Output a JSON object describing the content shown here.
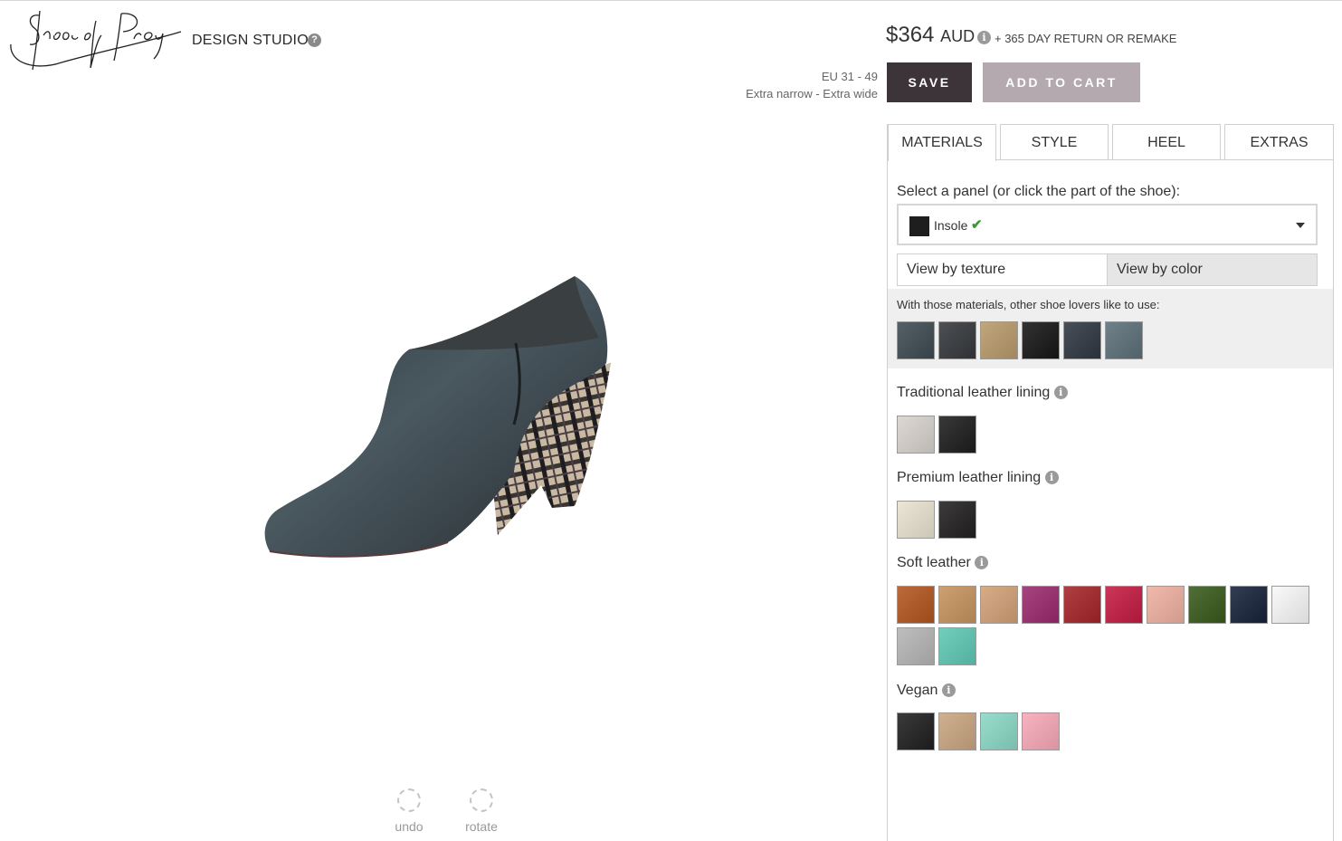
{
  "brand": {
    "logo_alt": "Shoes of Prey",
    "studio_label": "DESIGN STUDIO",
    "help_icon": "?"
  },
  "price": {
    "amount": "$364",
    "currency": "AUD",
    "info_icon": "i",
    "returns": "+ 365 DAY RETURN OR REMAKE"
  },
  "sizes": {
    "range": "EU 31 - 49",
    "widths": "Extra narrow - Extra wide"
  },
  "actions": {
    "save": "SAVE",
    "add_to_cart": "ADD TO CART"
  },
  "tabs": [
    {
      "label": "MATERIALS",
      "active": true
    },
    {
      "label": "STYLE",
      "active": false
    },
    {
      "label": "HEEL",
      "active": false
    },
    {
      "label": "EXTRAS",
      "active": false
    }
  ],
  "materials": {
    "select_label": "Select a panel (or click the part of the shoe):",
    "selected_panel": "Insole",
    "selected_check": "✔",
    "view_by_texture": "View by texture",
    "view_by_color": "View by color",
    "recommend_label": "With those materials, other shoe lovers like to use:",
    "recommended": [
      "#3e4a52",
      "#35383c",
      "#b89a6a",
      "#161616",
      "#2f3741",
      "#5c6f78"
    ],
    "groups": [
      {
        "name": "Traditional leather lining",
        "info": "i",
        "colors": [
          "#d7d2cc",
          "#1d1d1d"
        ]
      },
      {
        "name": "Premium leather lining",
        "info": "i",
        "colors": [
          "#e8e2cf",
          "#222020"
        ]
      },
      {
        "name": "Soft leather",
        "info": "i",
        "colors": [
          "#b3551e",
          "#c5935e",
          "#d1a177",
          "#9a2a6e",
          "#a42427",
          "#c41b41",
          "#eeb0a0",
          "#3a5a1c",
          "#17223a",
          "#f8f8f8",
          "#b5b5b5",
          "#5ec8b5"
        ]
      },
      {
        "name": "Vegan",
        "info": "i",
        "colors": [
          "#1f1f1f",
          "#c9a580",
          "#8ad8c5",
          "#f7a8b8"
        ]
      }
    ]
  },
  "viewer": {
    "undo": "undo",
    "rotate": "rotate"
  }
}
